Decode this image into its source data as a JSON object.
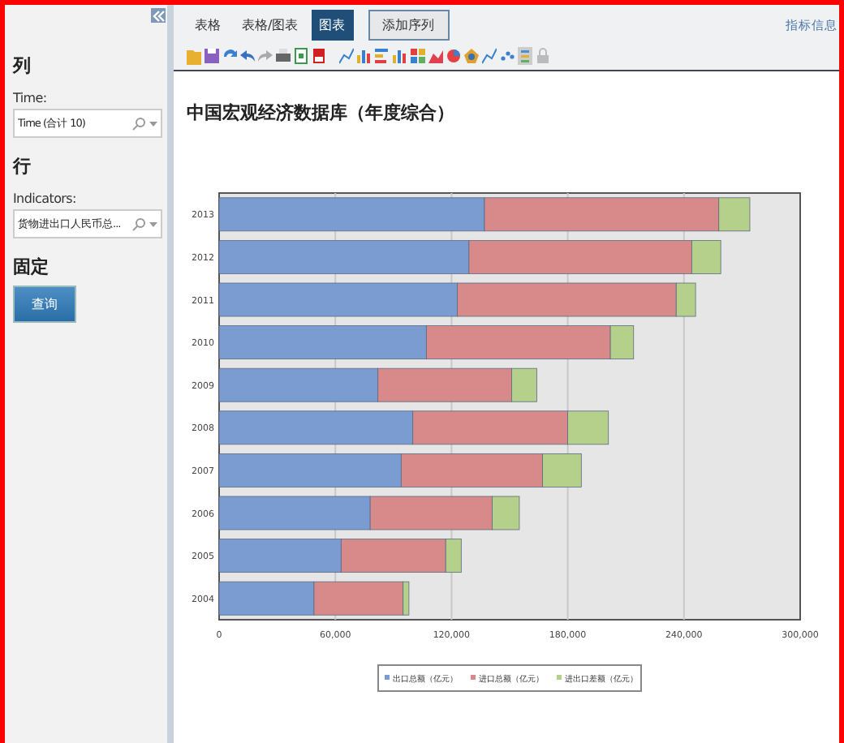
{
  "sidebar": {
    "sections": [
      {
        "heading": "列",
        "label": "Time:",
        "field_value": "Time (合计 10)"
      },
      {
        "heading": "行",
        "label": "Indicators:",
        "field_value": "货物进出口人民币总..."
      }
    ],
    "fixed_heading": "固定",
    "query_button": "查询"
  },
  "tabs": [
    {
      "label": "表格",
      "selected": false
    },
    {
      "label": "表格/图表",
      "selected": false
    },
    {
      "label": "图表",
      "selected": true
    }
  ],
  "add_series_button": "添加序列",
  "info_link": "指标信息",
  "chart_title": "中国宏观经济数据库（年度综合）",
  "chart_data": {
    "type": "bar",
    "orientation": "horizontal",
    "stacked": true,
    "grid": true,
    "legend": true,
    "categories": [
      "2013",
      "2012",
      "2011",
      "2010",
      "2009",
      "2008",
      "2007",
      "2006",
      "2005",
      "2004"
    ],
    "xlim": [
      0,
      300000
    ],
    "xticks": [
      {
        "value": 0,
        "label": "0"
      },
      {
        "value": 60000,
        "label": "60,000"
      },
      {
        "value": 120000,
        "label": "120,000"
      },
      {
        "value": 180000,
        "label": "180,000"
      },
      {
        "value": 240000,
        "label": "240,000"
      },
      {
        "value": 300000,
        "label": "300,000"
      }
    ],
    "series": [
      {
        "name": "出口总额（亿元）",
        "color": "#7a9cd0",
        "values": [
          137000,
          129000,
          123000,
          107000,
          82000,
          100000,
          94000,
          78000,
          63000,
          49000
        ]
      },
      {
        "name": "进口总额（亿元）",
        "color": "#d88a8a",
        "values": [
          121000,
          115000,
          113000,
          95000,
          69000,
          80000,
          73000,
          63000,
          54000,
          46000
        ]
      },
      {
        "name": "进出口差额（亿元）",
        "color": "#b5d08a",
        "values": [
          16000,
          15000,
          10000,
          12000,
          13000,
          21000,
          20000,
          14000,
          8000,
          3000
        ]
      }
    ]
  }
}
